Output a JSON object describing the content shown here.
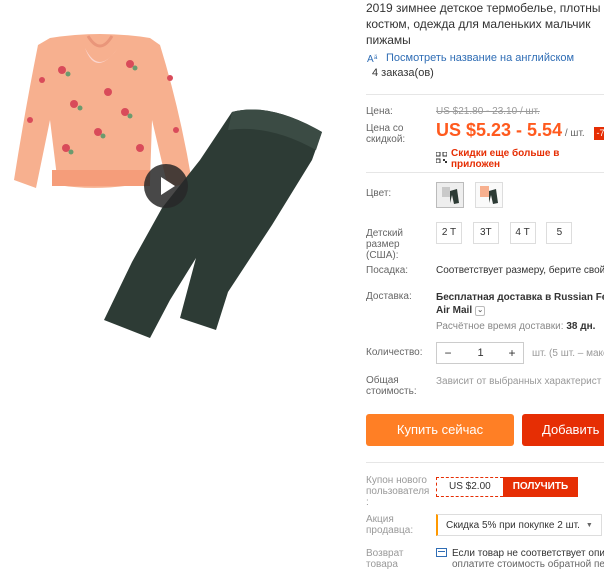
{
  "product": {
    "title_line1": "2019 зимнее детское термобелье, плотны",
    "title_line2": "костюм, одежда для маленьких мальчик",
    "title_line3": "пижамы",
    "translate_link": "Посмотреть название на английском",
    "orders": "4 заказа(ов)"
  },
  "price": {
    "price_label": "Цена:",
    "old_price": "US $21.80 - 23.10 / шт.",
    "discount_label_1": "Цена со",
    "discount_label_2": "скидкой:",
    "sale_price": "US $5.23 - 5.54",
    "unit": "/ шт.",
    "badge": "-7",
    "app_discount": "Скидки еще больше в приложен"
  },
  "options": {
    "color_label": "Цвет:",
    "size_label_1": "Детский",
    "size_label_2": "размер",
    "size_label_3": "(США):",
    "sizes": [
      "2 T",
      "3T",
      "4 T",
      "5"
    ],
    "fit_label": "Посадка:",
    "fit_value": "Соответствует размеру, берите свой",
    "shipping_label": "Доставка:",
    "shipping_bold": "Бесплатная доставка",
    "shipping_in": "в Russian Fe",
    "shipping_method": "Air Mail",
    "delivery_label": "Расчётное время доставки:",
    "delivery_days": "38 дн.",
    "qty_label": "Количество:",
    "qty_value": "1",
    "qty_minus": "−",
    "qty_plus": "+",
    "qty_note": "шт. (5 шт. – макси",
    "total_label_1": "Общая",
    "total_label_2": "стоимость:",
    "total_value": "Зависит от выбранных характерист"
  },
  "actions": {
    "buy_now": "Купить сейчас",
    "add_to_cart": "Добавить"
  },
  "extras": {
    "coupon_label_1": "Купон нового",
    "coupon_label_2": "пользователя",
    "coupon_label_3": ":",
    "coupon_amount": "US $2.00",
    "coupon_get": "ПОЛУЧИТЬ",
    "promo_label_1": "Акция",
    "promo_label_2": "продавца:",
    "promo_value": "Скидка 5% при покупке 2 шт.",
    "return_label_1": "Возврат",
    "return_label_2": "товара",
    "return_line1": "Если товар не соответствует опи",
    "return_line2": "оплатите стоимость обратной пе"
  },
  "colors": {
    "accent": "#ff5a1e",
    "buy_button": "#ff7f25",
    "cart_button": "#e62e04",
    "link": "#2f6db5"
  }
}
